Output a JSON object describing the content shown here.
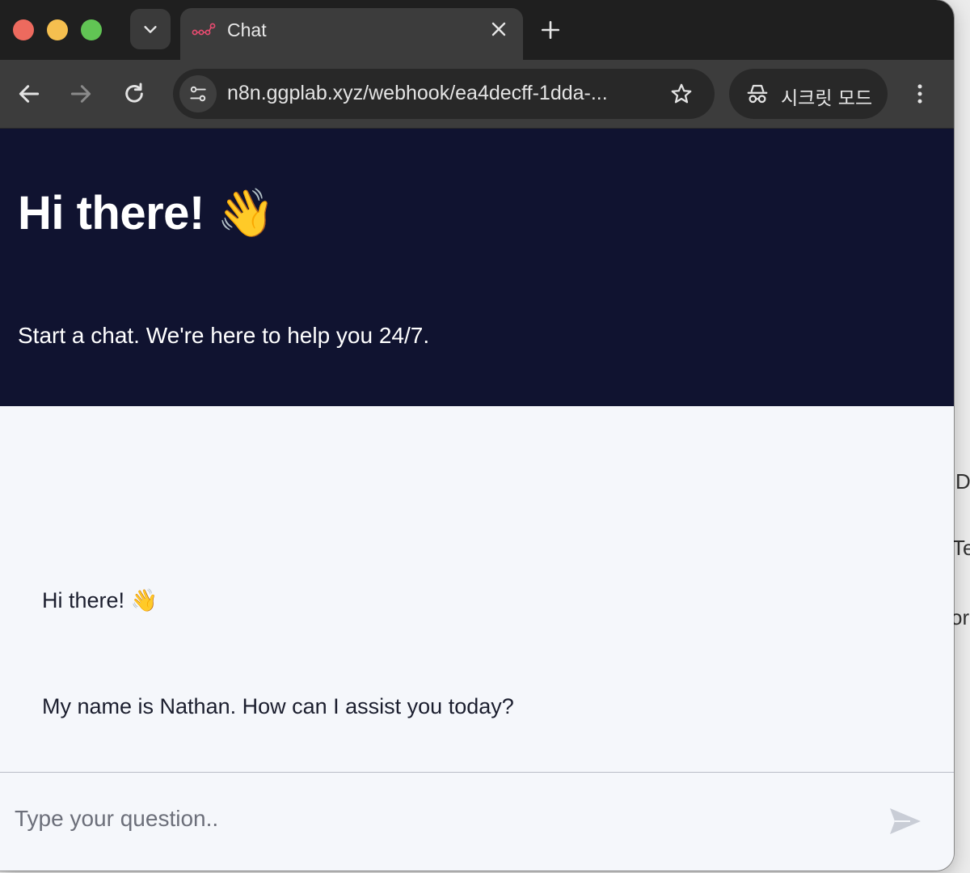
{
  "browser": {
    "tab": {
      "title": "Chat",
      "favicon": "n8n-workflow-icon"
    },
    "url": "n8n.ggplab.xyz/webhook/ea4decff-1dda-...",
    "incognito_label": "시크릿 모드",
    "icons": {
      "tab_search": "chevron-down-icon",
      "close": "close-icon",
      "new_tab": "plus-icon",
      "back": "arrow-left-icon",
      "forward": "arrow-right-icon",
      "reload": "reload-icon",
      "site_info": "tune-icon",
      "bookmark": "star-icon",
      "incognito": "incognito-icon",
      "menu": "kebab-menu-icon"
    }
  },
  "chat": {
    "header": {
      "title": "Hi there!",
      "title_emoji": "👋",
      "subtitle": "Start a chat. We're here to help you 24/7."
    },
    "messages": [
      {
        "text": "Hi there!",
        "emoji": "👋"
      },
      {
        "text": "My name is Nathan. How can I assist you today?",
        "emoji": ""
      }
    ],
    "input": {
      "placeholder": "Type your question..",
      "value": ""
    },
    "colors": {
      "header_bg": "#101330",
      "body_bg": "#f5f7fb",
      "send_icon": "#c9cdd6"
    }
  },
  "background_window": {
    "fragments": [
      "D",
      "Te",
      "or"
    ]
  }
}
